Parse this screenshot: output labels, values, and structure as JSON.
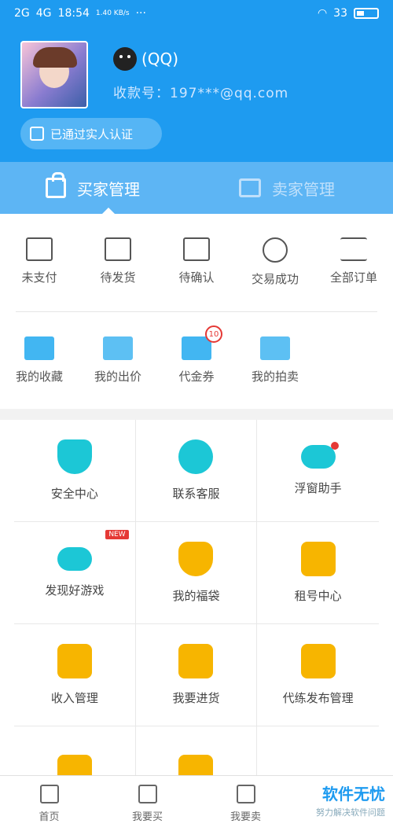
{
  "status_bar": {
    "network": "2G",
    "network2": "4G",
    "time": "18:54",
    "speed": "1.40 KB/s",
    "dots": "···",
    "battery": "33"
  },
  "profile": {
    "nickname": "(QQ)",
    "collect_label": "收款号：197***@qq.com",
    "verified": "已通过实人认证"
  },
  "tabs": {
    "buyer": "买家管理",
    "seller": "卖家管理"
  },
  "orders": [
    {
      "label": "未支付",
      "icon": "wallet-icon"
    },
    {
      "label": "待发货",
      "icon": "truck-icon"
    },
    {
      "label": "待确认",
      "icon": "box-icon"
    },
    {
      "label": "交易成功",
      "icon": "smile-icon"
    },
    {
      "label": "全部订单",
      "icon": "list-icon"
    }
  ],
  "quick": [
    {
      "label": "我的收藏",
      "icon": "folder-star-icon"
    },
    {
      "label": "我的出价",
      "icon": "bid-icon"
    },
    {
      "label": "代金券",
      "icon": "coupon-icon",
      "badge": "10"
    },
    {
      "label": "我的拍卖",
      "icon": "hammer-icon"
    }
  ],
  "services": [
    {
      "label": "安全中心",
      "icon": "shield-icon",
      "color": "#1cc7d6"
    },
    {
      "label": "联系客服",
      "icon": "service-girl-icon",
      "color": "#1cc7d6"
    },
    {
      "label": "浮窗助手",
      "icon": "gamepad-icon",
      "color": "#1cc7d6"
    },
    {
      "label": "发现好游戏",
      "icon": "gamepad-new-icon",
      "color": "#1cc7d6",
      "badge": "NEW"
    },
    {
      "label": "我的福袋",
      "icon": "lucky-bag-icon",
      "color": "#f7b500"
    },
    {
      "label": "租号中心",
      "icon": "rent-clipboard-icon",
      "color": "#f7b500"
    },
    {
      "label": "收入管理",
      "icon": "calculator-icon",
      "color": "#f7b500"
    },
    {
      "label": "我要进货",
      "icon": "shopping-bag-icon",
      "color": "#f7b500"
    },
    {
      "label": "代练发布管理",
      "icon": "note-icon",
      "color": "#f7b500"
    },
    {
      "label": "",
      "icon": "yuan-icon",
      "color": "#f7b500"
    },
    {
      "label": "",
      "icon": "shop-icon",
      "color": "#f7b500"
    },
    {
      "label": "",
      "icon": "",
      "color": ""
    }
  ],
  "bottom_nav": [
    {
      "label": "首页",
      "icon": "home-icon"
    },
    {
      "label": "我要买",
      "icon": "bag-icon"
    },
    {
      "label": "我要卖",
      "icon": "store-icon"
    },
    {
      "label": "",
      "icon": ""
    }
  ],
  "watermark": {
    "title": "软件无忧",
    "subtitle": "努力解决软件问题"
  },
  "colors": {
    "primary": "#1e9bf0",
    "tab_bg": "#5db5f4",
    "teal": "#1cc7d6",
    "gold": "#f7b500"
  }
}
